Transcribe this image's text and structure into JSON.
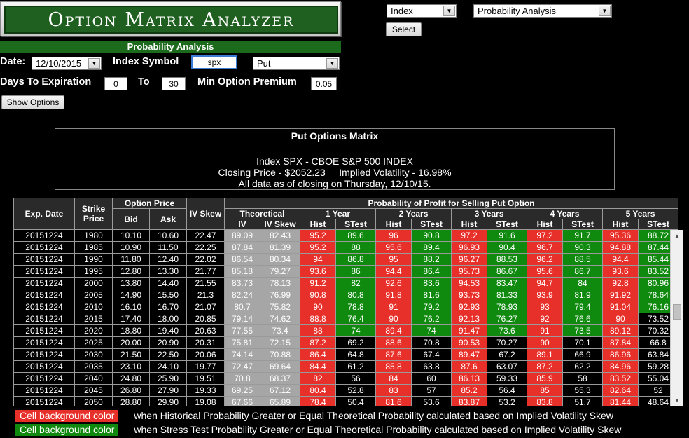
{
  "logo": {
    "title": "Option Matrix Analyzer"
  },
  "top": {
    "index_select": "Index",
    "analysis_select": "Probability Analysis",
    "select_label": "Select"
  },
  "form": {
    "section_title": "Probability Analysis",
    "date_label": "Date:",
    "date_value": "12/10/2015",
    "index_label": "Index Symbol",
    "index_value": "spx",
    "type_value": "Put",
    "dte_label": "Days To Expiration",
    "dte_from": "0",
    "to_label": "To",
    "dte_to": "30",
    "min_prem_label": "Min Option Premium",
    "min_prem_value": "0.05",
    "show_button": "Show Options"
  },
  "info": {
    "title": "Put Options Matrix",
    "line1": "Index SPX - CBOE S&P 500 INDEX",
    "line2": "Closing Price - $2052.23     Implied Volatility - 16.98%",
    "line3": "All data as of closing on Thursday, 12/10/15."
  },
  "table": {
    "h_exp": "Exp. Date",
    "h_strike": "Strike Price",
    "h_optprice": "Option Price",
    "h_bid": "Bid",
    "h_ask": "Ask",
    "h_ivskew": "IV Skew",
    "h_prob": "Probability of Profit for Selling Put Option",
    "h_theo": "Theoretical",
    "h_iv": "IV",
    "h_ivs": "IV Skew",
    "h_1y": "1 Year",
    "h_2y": "2 Years",
    "h_3y": "3 Years",
    "h_4y": "4 Years",
    "h_5y": "5 Years",
    "h_hist": "Hist",
    "h_stest": "STest",
    "rows": [
      [
        "20151224",
        "1980",
        "10.10",
        "10.60",
        "22.47",
        "89.09",
        "82.43",
        "95.2",
        "89.6",
        "96",
        "90.8",
        "97.2",
        "91.6",
        "97.2",
        "91.7",
        "95.36",
        "88.72"
      ],
      [
        "20151224",
        "1985",
        "10.90",
        "11.50",
        "22.25",
        "87.84",
        "81.39",
        "95.2",
        "88",
        "95.6",
        "89.4",
        "96.93",
        "90.4",
        "96.7",
        "90.3",
        "94.88",
        "87.44"
      ],
      [
        "20151224",
        "1990",
        "11.80",
        "12.40",
        "22.02",
        "86.54",
        "80.34",
        "94",
        "86.8",
        "95",
        "88.2",
        "96.27",
        "88.53",
        "96.2",
        "88.5",
        "94.4",
        "85.44"
      ],
      [
        "20151224",
        "1995",
        "12.80",
        "13.30",
        "21.77",
        "85.18",
        "79.27",
        "93.6",
        "86",
        "94.4",
        "86.4",
        "95.73",
        "86.67",
        "95.6",
        "86.7",
        "93.6",
        "83.52"
      ],
      [
        "20151224",
        "2000",
        "13.80",
        "14.40",
        "21.55",
        "83.73",
        "78.13",
        "91.2",
        "82",
        "92.6",
        "83.6",
        "94.53",
        "83.47",
        "94.7",
        "84",
        "92.8",
        "80.96"
      ],
      [
        "20151224",
        "2005",
        "14.90",
        "15.50",
        "21.3",
        "82.24",
        "76.99",
        "90.8",
        "80.8",
        "91.8",
        "81.6",
        "93.73",
        "81.33",
        "93.9",
        "81.9",
        "91.92",
        "78.64"
      ],
      [
        "20151224",
        "2010",
        "16.10",
        "16.70",
        "21.07",
        "80.7",
        "75.82",
        "90",
        "78.8",
        "91",
        "79.2",
        "92.93",
        "78.93",
        "93",
        "79.4",
        "91.04",
        "76.16"
      ],
      [
        "20151224",
        "2015",
        "17.40",
        "18.00",
        "20.85",
        "79.14",
        "74.62",
        "88.8",
        "76.4",
        "90",
        "76.2",
        "92.13",
        "76.27",
        "92",
        "76.6",
        "90",
        "73.52"
      ],
      [
        "20151224",
        "2020",
        "18.80",
        "19.40",
        "20.63",
        "77.55",
        "73.4",
        "88",
        "74",
        "89.4",
        "74",
        "91.47",
        "73.6",
        "91",
        "73.5",
        "89.12",
        "70.32"
      ],
      [
        "20151224",
        "2025",
        "20.00",
        "20.90",
        "20.31",
        "75.81",
        "72.15",
        "87.2",
        "69.2",
        "88.6",
        "70.8",
        "90.53",
        "70.27",
        "90",
        "70.1",
        "87.84",
        "66.8"
      ],
      [
        "20151224",
        "2030",
        "21.50",
        "22.50",
        "20.06",
        "74.14",
        "70.88",
        "86.4",
        "64.8",
        "87.6",
        "67.4",
        "89.47",
        "67.2",
        "89.1",
        "66.9",
        "86.96",
        "63.84"
      ],
      [
        "20151224",
        "2035",
        "23.10",
        "24.10",
        "19.77",
        "72.47",
        "69.64",
        "84.4",
        "61.2",
        "85.8",
        "63.8",
        "87.6",
        "63.07",
        "87.2",
        "62.2",
        "84.96",
        "59.28"
      ],
      [
        "20151224",
        "2040",
        "24.80",
        "25.90",
        "19.51",
        "70.8",
        "68.37",
        "82",
        "56",
        "84",
        "60",
        "86.13",
        "59.33",
        "85.9",
        "58",
        "83.52",
        "55.04"
      ],
      [
        "20151224",
        "2045",
        "26.80",
        "27.90",
        "19.33",
        "69.25",
        "67.12",
        "80.4",
        "52.8",
        "83",
        "57",
        "85.2",
        "56.4",
        "85",
        "55.3",
        "82.64",
        "52"
      ],
      [
        "20151224",
        "2050",
        "28.80",
        "29.90",
        "19.08",
        "67.66",
        "65.89",
        "78.4",
        "50.4",
        "81.6",
        "53.6",
        "83.87",
        "53.2",
        "83.8",
        "51.7",
        "81.44",
        "48.64"
      ]
    ]
  },
  "legend": {
    "swatch_label": "Cell background color",
    "red_text": "when Historical Probability Greater or Equal Theoretical Probability calculated based on Implied Volatility Skew",
    "green_text": "when Stress Test Probability Greater or Equal Theoretical Probability calculated based on Implied Volatility Skew",
    "red": "#e8302a",
    "green": "#0f8a0f"
  }
}
